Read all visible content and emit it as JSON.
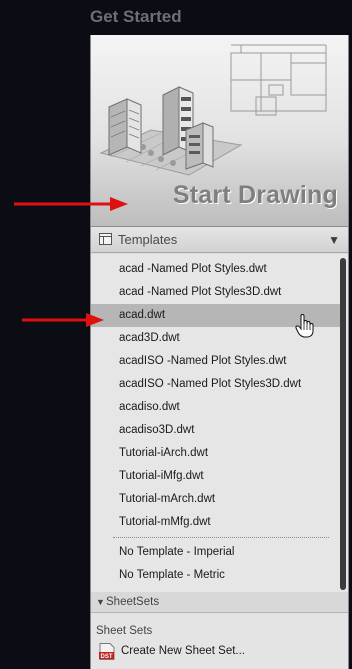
{
  "heading": "Get Started",
  "start_drawing": {
    "label": "Start Drawing"
  },
  "templates": {
    "header_label": "Templates",
    "caret": "▼",
    "items": [
      "acad -Named Plot Styles.dwt",
      "acad -Named Plot Styles3D.dwt",
      "acad.dwt",
      "acad3D.dwt",
      "acadISO -Named Plot Styles.dwt",
      "acadISO -Named Plot Styles3D.dwt",
      "acadiso.dwt",
      "acadiso3D.dwt",
      "Tutorial-iArch.dwt",
      "Tutorial-iMfg.dwt",
      "Tutorial-mArch.dwt",
      "Tutorial-mMfg.dwt"
    ],
    "no_template_items": [
      "No Template - Imperial",
      "No Template - Metric"
    ],
    "selected": "acad.dwt"
  },
  "sheetsets": {
    "header_label": "SheetSets",
    "caret": "▼",
    "section_title": "Sheet Sets",
    "create_label": "Create New Sheet Set...",
    "icon_text": "DST"
  },
  "annotation_color": "#e01010"
}
